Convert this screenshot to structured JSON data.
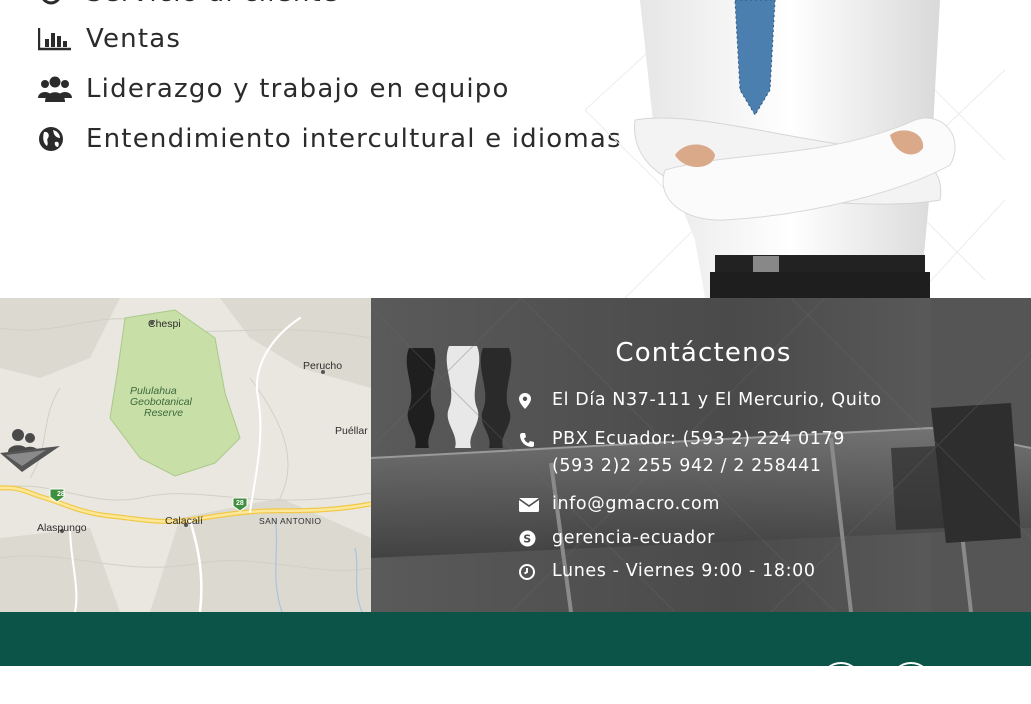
{
  "skills": {
    "items": [
      {
        "label": "Servicio al cliente",
        "icon": "headset-icon"
      },
      {
        "label": "Ventas",
        "icon": "bar-chart-icon"
      },
      {
        "label": "Liderazgo y trabajo en equipo",
        "icon": "users-icon"
      },
      {
        "label": "Entendimiento intercultural e idiomas",
        "icon": "globe-icon"
      }
    ]
  },
  "map": {
    "labels": {
      "chespi": "Chespi",
      "perucho": "Perucho",
      "pululahua": "Pululahua",
      "geobotanical": "Geobotanical",
      "reserve": "Reserve",
      "puellaro": "Puéllar",
      "alaspungo": "Alaspungo",
      "calacali": "Calacalí",
      "san_antonio": "SAN ANTONIO",
      "route_1": "28",
      "route_2": "28"
    },
    "marker_icon": "location-logo-icon"
  },
  "contact": {
    "title": "Contáctenos",
    "address": "El Día N37-111 y El Mercurio, Quito",
    "phone_line1": "PBX Ecuador: (593 2) 224 0179",
    "phone_line2": "(593 2)2 255 942 / 2 258441",
    "email": "info@gmacro.com",
    "skype": "gerencia-ecuador",
    "hours": "Lunes - Viernes 9:00 - 18:00"
  },
  "colors": {
    "footer": "#0c5447",
    "contact_panel": "#4d4d4d",
    "text_dark": "#2b2b2b",
    "map_park": "#c9dfa8"
  }
}
